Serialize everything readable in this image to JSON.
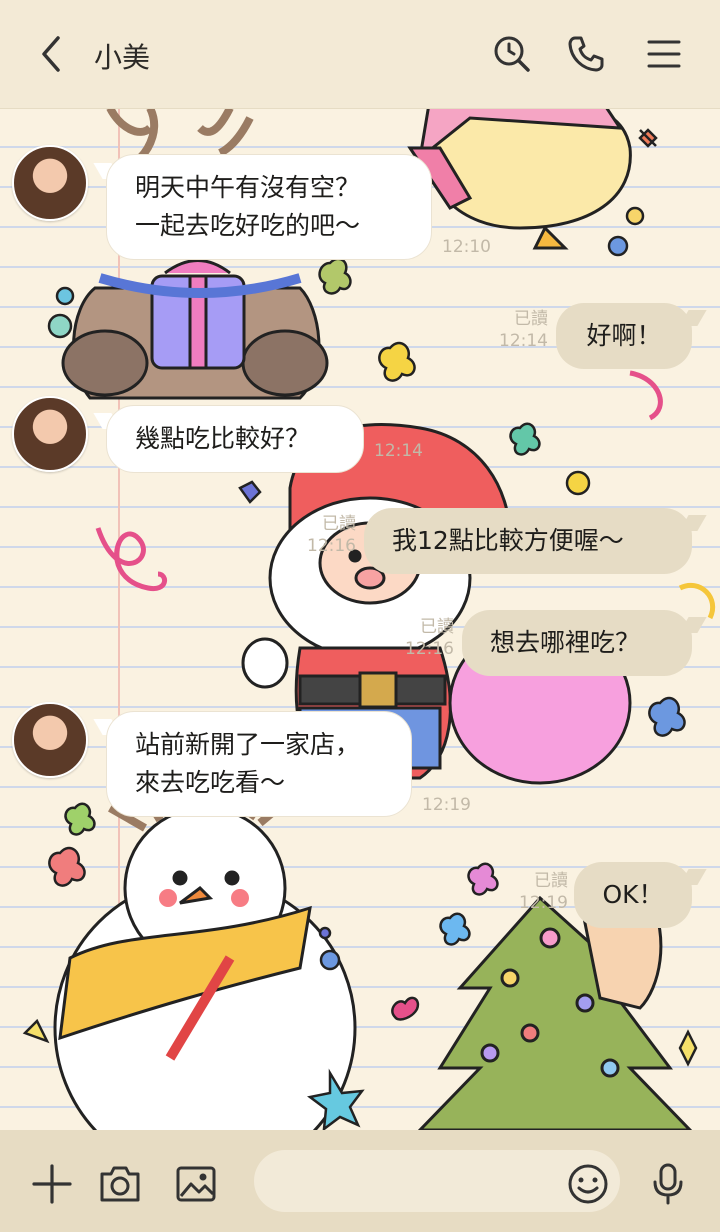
{
  "header": {
    "title": "小美",
    "icons": [
      "back-chevron-icon",
      "search-clock-icon",
      "phone-icon",
      "menu-icon"
    ]
  },
  "messages": [
    {
      "side": "in",
      "text": "明天中午有沒有空？\n一起去吃好吃的吧〜",
      "time": "12:10"
    },
    {
      "side": "out",
      "text": "好啊！",
      "read": "已讀",
      "time": "12:14"
    },
    {
      "side": "in",
      "text": "幾點吃比較好？",
      "time": "12:14"
    },
    {
      "side": "out",
      "text": "我12點比較方便喔〜",
      "read": "已讀",
      "time": "12:16"
    },
    {
      "side": "out",
      "text": "想去哪裡吃？",
      "read": "已讀",
      "time": "12:16"
    },
    {
      "side": "in",
      "text": "站前新開了一家店，\n來去吃吃看〜",
      "time": "12:19"
    },
    {
      "side": "out",
      "text": "OK！",
      "read": "已讀",
      "time": "12:19"
    }
  ],
  "input": {
    "placeholder": "",
    "icons": [
      "plus-icon",
      "camera-icon",
      "image-icon",
      "emoji-icon",
      "microphone-icon"
    ]
  },
  "theme": {
    "accent": "#e6dcc5",
    "background": "#faf2e1",
    "header_bg": "#f3ead6"
  }
}
